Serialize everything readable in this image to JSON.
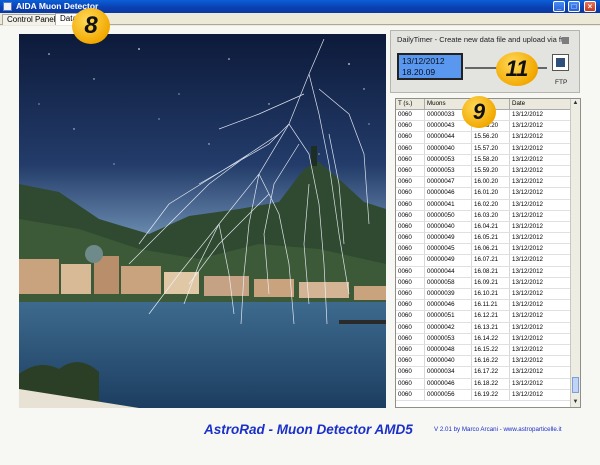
{
  "window": {
    "title": "AIDA Muon Detector"
  },
  "tabs": [
    {
      "label": "Control Panel"
    },
    {
      "label": "Data"
    }
  ],
  "timer": {
    "label": "DailyTimer - Create new data file and upload via ftp",
    "date": "13/12/2012",
    "time": "18.20.09",
    "ftp_label": "FTP"
  },
  "table": {
    "columns": [
      "T (s.)",
      "Muons",
      "Time",
      "Date"
    ],
    "rows": [
      [
        "0060",
        "00000033",
        "",
        "13/12/2012"
      ],
      [
        "0060",
        "00000043",
        "15.55.20",
        "13/12/2012"
      ],
      [
        "0060",
        "00000044",
        "15.56.20",
        "13/12/2012"
      ],
      [
        "0060",
        "00000040",
        "15.57.20",
        "13/12/2012"
      ],
      [
        "0060",
        "00000053",
        "15.58.20",
        "13/12/2012"
      ],
      [
        "0060",
        "00000053",
        "15.59.20",
        "13/12/2012"
      ],
      [
        "0060",
        "00000047",
        "16.00.20",
        "13/12/2012"
      ],
      [
        "0060",
        "00000046",
        "16.01.20",
        "13/12/2012"
      ],
      [
        "0060",
        "00000041",
        "16.02.20",
        "13/12/2012"
      ],
      [
        "0060",
        "00000050",
        "16.03.20",
        "13/12/2012"
      ],
      [
        "0060",
        "00000040",
        "16.04.21",
        "13/12/2012"
      ],
      [
        "0060",
        "00000049",
        "16.05.21",
        "13/12/2012"
      ],
      [
        "0060",
        "00000045",
        "16.06.21",
        "13/12/2012"
      ],
      [
        "0060",
        "00000049",
        "16.07.21",
        "13/12/2012"
      ],
      [
        "0060",
        "00000044",
        "16.08.21",
        "13/12/2012"
      ],
      [
        "0060",
        "00000058",
        "16.09.21",
        "13/12/2012"
      ],
      [
        "0060",
        "00000039",
        "16.10.21",
        "13/12/2012"
      ],
      [
        "0060",
        "00000046",
        "16.11.21",
        "13/12/2012"
      ],
      [
        "0060",
        "00000051",
        "16.12.21",
        "13/12/2012"
      ],
      [
        "0060",
        "00000042",
        "16.13.21",
        "13/12/2012"
      ],
      [
        "0060",
        "00000053",
        "16.14.22",
        "13/12/2012"
      ],
      [
        "0060",
        "00000048",
        "16.15.22",
        "13/12/2012"
      ],
      [
        "0060",
        "00000040",
        "16.16.22",
        "13/12/2012"
      ],
      [
        "0060",
        "00000034",
        "16.17.22",
        "13/12/2012"
      ],
      [
        "0060",
        "00000046",
        "16.18.22",
        "13/12/2012"
      ],
      [
        "0060",
        "00000056",
        "16.19.22",
        "13/12/2012"
      ]
    ]
  },
  "badges": {
    "tab": "8",
    "table": "9",
    "timer": "11"
  },
  "footer": {
    "title": "AstroRad - Muon Detector AMD5",
    "credit": "V 2.01 by Marco Arcani - www.astroparticelle.it"
  },
  "colors": {
    "titlebar": "#0b3fb0",
    "timer_display": "#5a98f0",
    "footer_text": "#1a30c8",
    "badge": "#f2a900"
  }
}
